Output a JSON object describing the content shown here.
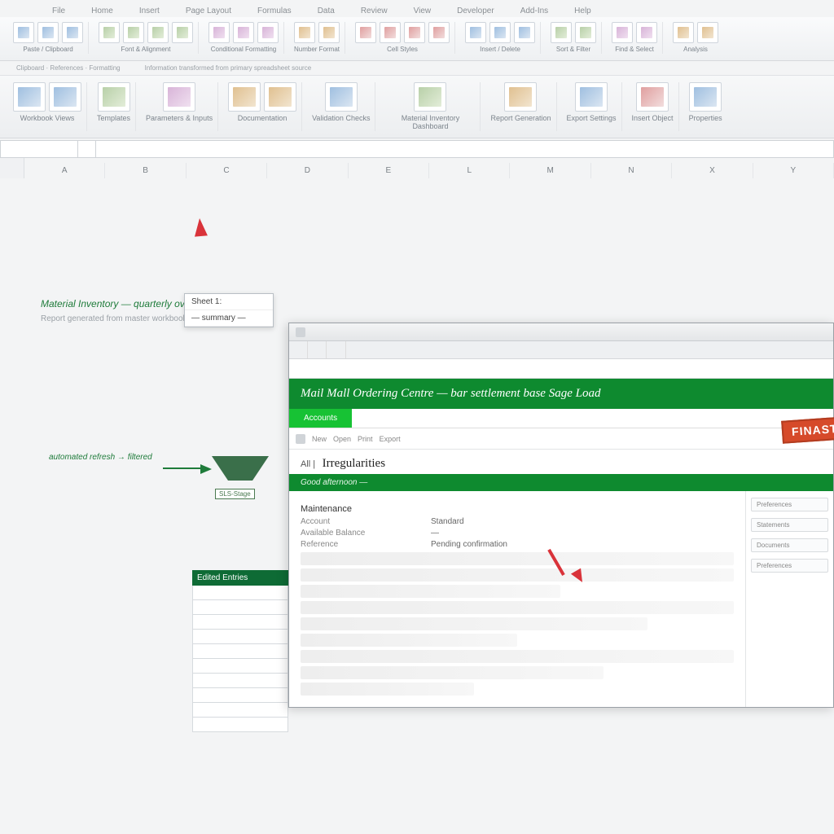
{
  "tabs": [
    "File",
    "Home",
    "Insert",
    "Page Layout",
    "Formulas",
    "Data",
    "Review",
    "View",
    "Developer",
    "Add-Ins",
    "Help"
  ],
  "ribbon1": {
    "groups": [
      {
        "label": "Paste / Clipboard",
        "icons": 3
      },
      {
        "label": "Font & Alignment",
        "icons": 4
      },
      {
        "label": "Conditional Formatting",
        "icons": 3
      },
      {
        "label": "Number Format",
        "icons": 2
      },
      {
        "label": "Cell Styles",
        "icons": 4
      },
      {
        "label": "Insert / Delete",
        "icons": 3
      },
      {
        "label": "Sort & Filter",
        "icons": 2
      },
      {
        "label": "Find & Select",
        "icons": 2
      },
      {
        "label": "Analysis",
        "icons": 2
      }
    ],
    "subline_left": "Clipboard · References · Formatting",
    "subline_right": "Information transformed from primary spreadsheet source"
  },
  "ribbon2": {
    "groups": [
      {
        "label": "Workbook Views",
        "icons": 2
      },
      {
        "label": "Templates",
        "icons": 1,
        "variant": "c2"
      },
      {
        "label": "Parameters & Inputs",
        "icons": 1,
        "variant": "c3"
      },
      {
        "label": "Documentation",
        "icons": 2,
        "variant": "c4"
      },
      {
        "label": "Validation Checks",
        "icons": 1
      },
      {
        "label": "Material Inventory Dashboard",
        "icons": 1,
        "variant": "c2"
      },
      {
        "label": "Report Generation",
        "icons": 1,
        "variant": "c4"
      },
      {
        "label": "Export Settings",
        "icons": 1
      },
      {
        "label": "Insert Object",
        "icons": 1,
        "variant": "c5"
      },
      {
        "label": "Properties",
        "icons": 1
      }
    ]
  },
  "columns": [
    "A",
    "B",
    "C",
    "D",
    "E",
    "L",
    "M",
    "N",
    "X",
    "Y"
  ],
  "left_block": {
    "link": "Material Inventory — quarterly overview",
    "note": "Report generated from master workbook",
    "dropdown": [
      "Sheet 1:",
      "— summary —"
    ]
  },
  "callout": "automated refresh → filtered",
  "small_badge": "SLS-Stage",
  "left_table_header": "Edited Entries",
  "overlay": {
    "banner": "Mail Mall Ordering Centre — bar settlement base Sage Load",
    "active_tab": "Accounts",
    "toolbar_items": [
      "New",
      "Open",
      "Print",
      "Export"
    ],
    "stamp": "FINAST",
    "sub_prefix": "All |",
    "sub_title": "Irregularities",
    "greenbar2": "Good afternoon —",
    "section1": "Maintenance",
    "rows": [
      {
        "lab": "Account",
        "val": "Standard"
      },
      {
        "lab": "Available Balance",
        "val": "—"
      },
      {
        "lab": "Reference",
        "val": "Pending confirmation"
      },
      {
        "lab": "",
        "val": ""
      }
    ],
    "side": [
      "Preferences",
      "Statements",
      "Documents",
      "Preferences"
    ]
  }
}
